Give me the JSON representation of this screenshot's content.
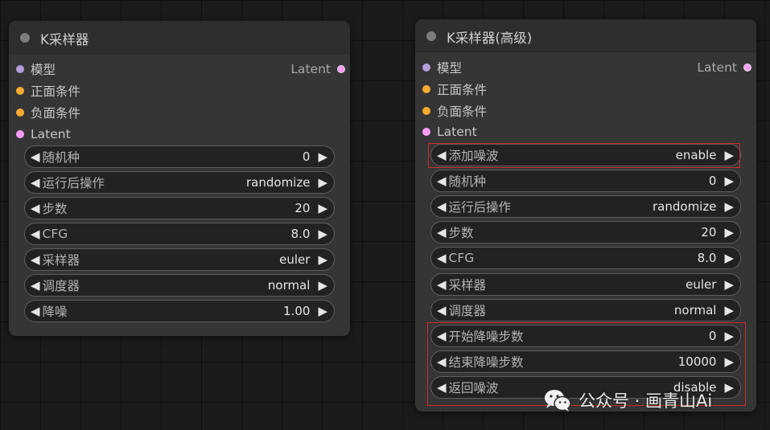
{
  "colors": {
    "model_slot": "#b39ddb",
    "conditioning_slot": "#ffa931",
    "latent_slot": "#ff9cf9",
    "highlight": "#cc2a2a"
  },
  "node1": {
    "title": "K采样器",
    "inputs": [
      {
        "label": "模型",
        "type": "model"
      },
      {
        "label": "正面条件",
        "type": "conditioning"
      },
      {
        "label": "负面条件",
        "type": "conditioning"
      },
      {
        "label": "Latent",
        "type": "latent"
      }
    ],
    "output": {
      "label": "Latent"
    },
    "widgets": [
      {
        "label": "随机种",
        "value": "0"
      },
      {
        "label": "运行后操作",
        "value": "randomize"
      },
      {
        "label": "步数",
        "value": "20"
      },
      {
        "label": "CFG",
        "value": "8.0"
      },
      {
        "label": "采样器",
        "value": "euler"
      },
      {
        "label": "调度器",
        "value": "normal"
      },
      {
        "label": "降噪",
        "value": "1.00"
      }
    ]
  },
  "node2": {
    "title": "K采样器(高级)",
    "inputs": [
      {
        "label": "模型",
        "type": "model"
      },
      {
        "label": "正面条件",
        "type": "conditioning"
      },
      {
        "label": "负面条件",
        "type": "conditioning"
      },
      {
        "label": "Latent",
        "type": "latent"
      }
    ],
    "output": {
      "label": "Latent"
    },
    "widgets": [
      {
        "label": "添加噪波",
        "value": "enable"
      },
      {
        "label": "随机种",
        "value": "0"
      },
      {
        "label": "运行后操作",
        "value": "randomize"
      },
      {
        "label": "步数",
        "value": "20"
      },
      {
        "label": "CFG",
        "value": "8.0"
      },
      {
        "label": "采样器",
        "value": "euler"
      },
      {
        "label": "调度器",
        "value": "normal"
      },
      {
        "label": "开始降噪步数",
        "value": "0"
      },
      {
        "label": "结束降噪步数",
        "value": "10000"
      },
      {
        "label": "返回噪波",
        "value": "disable"
      }
    ]
  },
  "arrows": {
    "left": "◀",
    "right": "▶"
  },
  "watermark": {
    "text": "公众号 · 画青山Ai",
    "icon": "wechat-icon"
  }
}
